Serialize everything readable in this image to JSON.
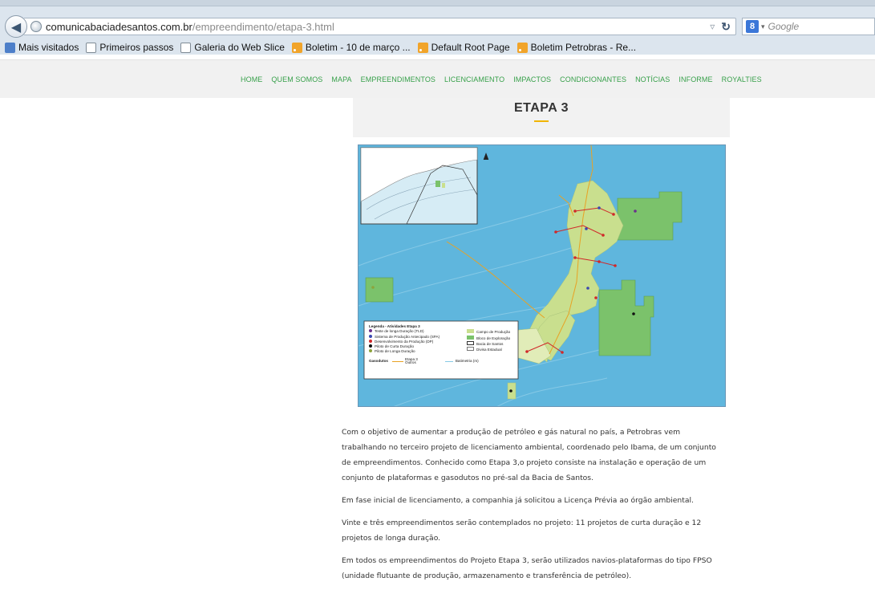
{
  "browser": {
    "url_domain": "comunicabaciadesantos.com.br",
    "url_path": "/empreendimento/etapa-3.html",
    "search_placeholder": "Google",
    "search_engine_icon": "g-icon"
  },
  "bookmarks": [
    {
      "label": "Mais visitados",
      "icon": "bookmark-star-icon"
    },
    {
      "label": "Primeiros passos",
      "icon": "page-icon"
    },
    {
      "label": "Galeria do Web Slice",
      "icon": "page-icon"
    },
    {
      "label": "Boletim - 10 de março ...",
      "icon": "rss-icon"
    },
    {
      "label": "Default Root Page",
      "icon": "rss-icon"
    },
    {
      "label": "Boletim Petrobras - Re...",
      "icon": "rss-icon"
    }
  ],
  "nav": {
    "items": [
      "HOME",
      "QUEM SOMOS",
      "MAPA",
      "EMPREENDIMENTOS",
      "LICENCIAMENTO",
      "IMPACTOS",
      "CONDICIONANTES",
      "NOTÍCIAS",
      "INFORME",
      "ROYALTIES"
    ],
    "color": "#37a04a"
  },
  "page": {
    "title": "ETAPA 3",
    "accent_color": "#f1b500"
  },
  "map": {
    "legend_title": "Legenda - Atividades Etapa 3",
    "legend_points": [
      {
        "label": "Teste de longa Duração (TLD)",
        "color": "#6b2f8c"
      },
      {
        "label": "Sistema de Produção Antecipado (SPA)",
        "color": "#3a48b0"
      },
      {
        "label": "Desenvolvimento da Produção (DP)",
        "color": "#d0282a"
      },
      {
        "label": "Piloto de Curta Duração",
        "color": "#111111"
      },
      {
        "label": "Piloto de Longa Duração",
        "color": "#8da33c"
      }
    ],
    "legend_areas": [
      {
        "label": "Campo de Produção",
        "color": "#c9df8e"
      },
      {
        "label": "Bloco de Exploração",
        "color": "#7bc26b"
      },
      {
        "label": "Bacia de Santos",
        "color": "#ffffff"
      },
      {
        "label": "Divisa Estadual",
        "color": "#ffffff"
      }
    ],
    "gasodutos_label": "Gasodutos",
    "gasodutos_items": [
      "Etapa 3",
      "Outros"
    ],
    "batimetria_label": "Batimetria (m)",
    "colors": {
      "ocean": "#5fb6dd",
      "field": "#c9df8e",
      "block": "#7bc26b",
      "pipeline": "#e8a224"
    }
  },
  "article": {
    "paragraphs": [
      "Com o objetivo de aumentar a produção de petróleo e gás natural no país, a Petrobras vem trabalhando no terceiro projeto de licenciamento ambiental, coordenado pelo Ibama, de um conjunto de empreendimentos. Conhecido como Etapa 3,o projeto consiste na instalação e operação de um conjunto de plataformas e gasodutos no pré-sal da Bacia de Santos.",
      "Em fase inicial de licenciamento, a companhia já solicitou a Licença Prévia ao órgão ambiental.",
      "Vinte e três empreendimentos serão contemplados no projeto: 11 projetos de curta duração e 12 projetos de longa duração.",
      "Em todos os empreendimentos do Projeto Etapa 3, serão utilizados navios-plataformas do tipo FPSO (unidade flutuante de produção, armazenamento e transferência de petróleo)."
    ]
  }
}
